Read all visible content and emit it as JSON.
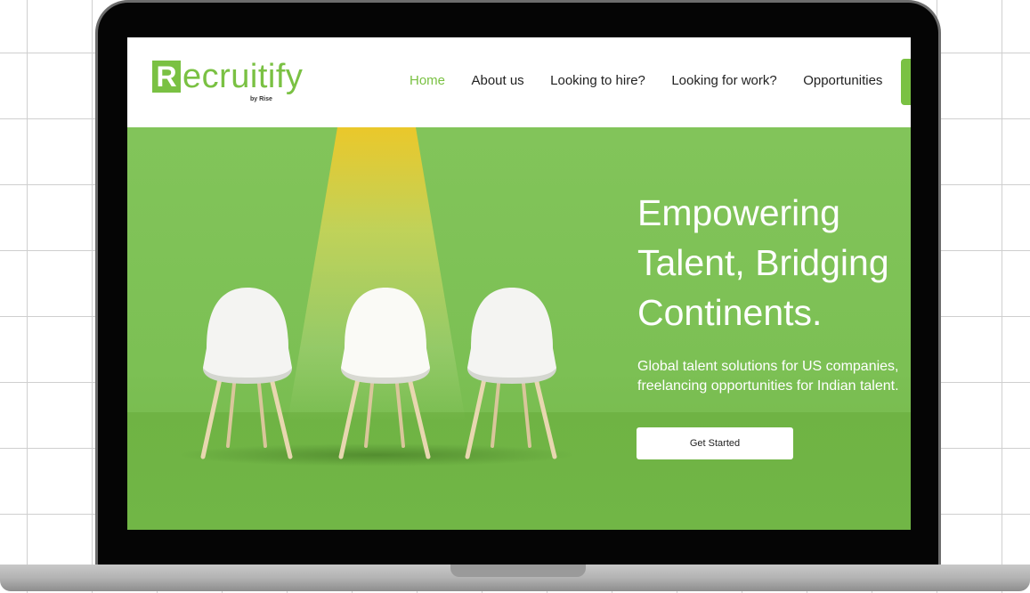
{
  "brand": {
    "logo_initial": "R",
    "logo_rest": "ecruitify",
    "logo_tagline": "by Rise",
    "accent_color": "#7ac143"
  },
  "nav": {
    "items": [
      {
        "label": "Home",
        "active": true
      },
      {
        "label": "About us",
        "active": false
      },
      {
        "label": "Looking to hire?",
        "active": false
      },
      {
        "label": "Looking for work?",
        "active": false
      },
      {
        "label": "Opportunities",
        "active": false
      }
    ]
  },
  "hero": {
    "headline": [
      "Empowering",
      "Talent, Bridging",
      "Continents."
    ],
    "subtext": "Global talent solutions for US companies, freelancing opportunities for Indian talent.",
    "cta_label": "Get Started",
    "image_icon": "white-chairs-under-spotlight"
  }
}
